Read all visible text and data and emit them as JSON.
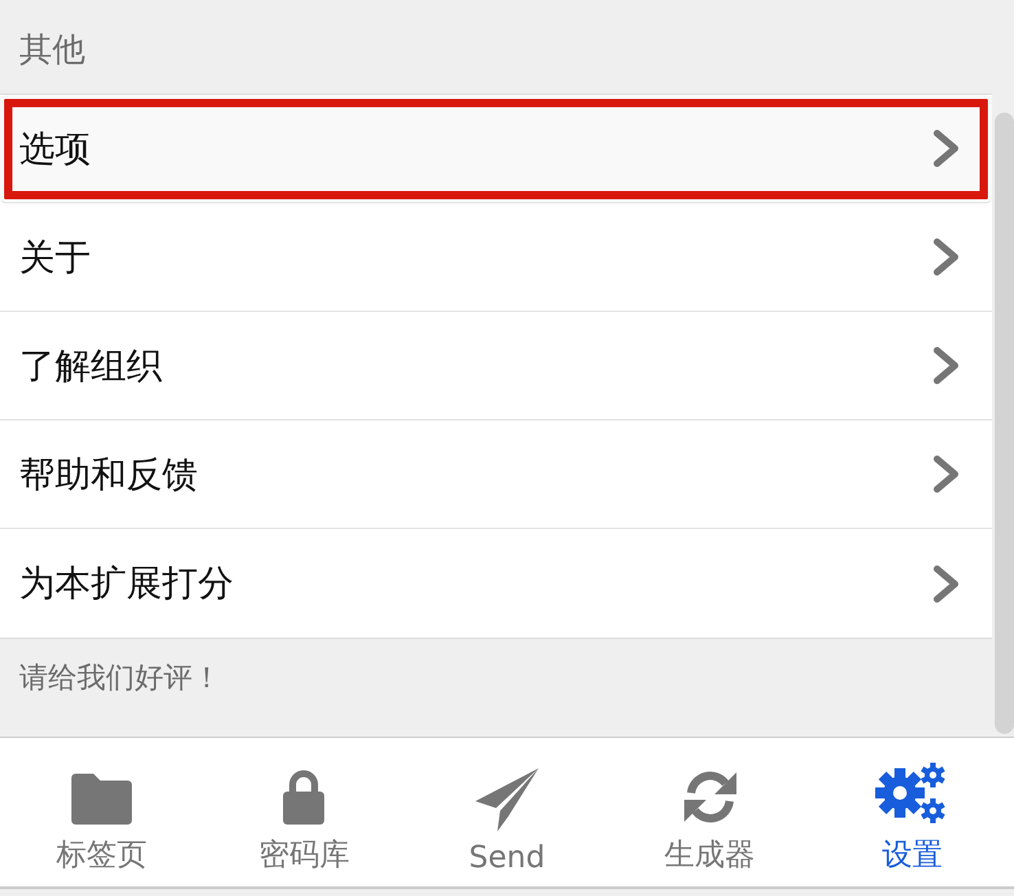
{
  "section": {
    "title": "其他"
  },
  "items": [
    {
      "label": "选项",
      "highlighted": true
    },
    {
      "label": "关于",
      "highlighted": false
    },
    {
      "label": "了解组织",
      "highlighted": false
    },
    {
      "label": "帮助和反馈",
      "highlighted": false
    },
    {
      "label": "为本扩展打分",
      "highlighted": false
    }
  ],
  "footer": "请给我们好评！",
  "tabs": [
    {
      "kind": "folder",
      "label": "标签页",
      "selected": false
    },
    {
      "kind": "lock",
      "label": "密码库",
      "selected": false
    },
    {
      "kind": "send",
      "label": "Send",
      "selected": false
    },
    {
      "kind": "sync",
      "label": "生成器",
      "selected": false
    },
    {
      "kind": "gears",
      "label": "设置",
      "selected": true
    }
  ]
}
